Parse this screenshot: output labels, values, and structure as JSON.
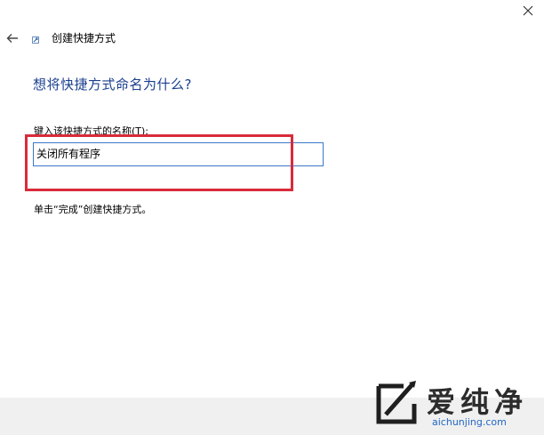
{
  "window": {
    "close_glyph": "✕",
    "back_icon": "back-arrow-icon",
    "wizard_title": "创建快捷方式"
  },
  "main": {
    "heading": "想将快捷方式命名为什么?",
    "field_label": "键入该快捷方式的名称(T):",
    "name_value": "关闭所有程序",
    "hint": "单击“完成”创建快捷方式。"
  },
  "watermark": {
    "name": "爱纯净",
    "url": "aichunjing.com"
  },
  "colors": {
    "heading": "#1a3f8f",
    "input_border": "#3a78c7",
    "highlight": "#d92b3a",
    "footer_bg": "#f0f0f0",
    "watermark_url": "#2167c7"
  }
}
